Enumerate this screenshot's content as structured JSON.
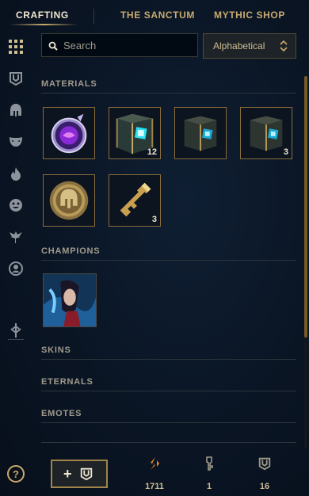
{
  "tabs": [
    {
      "label": "CRAFTING",
      "active": true
    },
    {
      "label": "THE SANCTUM",
      "active": false
    },
    {
      "label": "MYTHIC SHOP",
      "active": false
    }
  ],
  "search": {
    "placeholder": "Search"
  },
  "sort": {
    "value": "Alphabetical"
  },
  "sections": {
    "materials": "MATERIALS",
    "champions": "CHAMPIONS",
    "skins": "SKINS",
    "eternals": "ETERNALS",
    "emotes": "EMOTES"
  },
  "materials": [
    {
      "icon": "orb-icon",
      "count": ""
    },
    {
      "icon": "hextech-chest-icon",
      "count": "12"
    },
    {
      "icon": "masterwork-chest-icon",
      "count": ""
    },
    {
      "icon": "champion-chest-icon",
      "count": "3"
    },
    {
      "icon": "champion-token-icon",
      "count": ""
    },
    {
      "icon": "hextech-key-icon",
      "count": "3"
    }
  ],
  "footer": {
    "help": "?",
    "add_label": "+",
    "currencies": [
      {
        "icon": "orange-essence-icon",
        "value": "1711"
      },
      {
        "icon": "key-fragment-icon",
        "value": "1"
      },
      {
        "icon": "chest-count-icon",
        "value": "16"
      }
    ]
  },
  "colors": {
    "gold": "#c8aa6e",
    "accent_orange": "#f08a2a",
    "background": "#0a1524"
  }
}
